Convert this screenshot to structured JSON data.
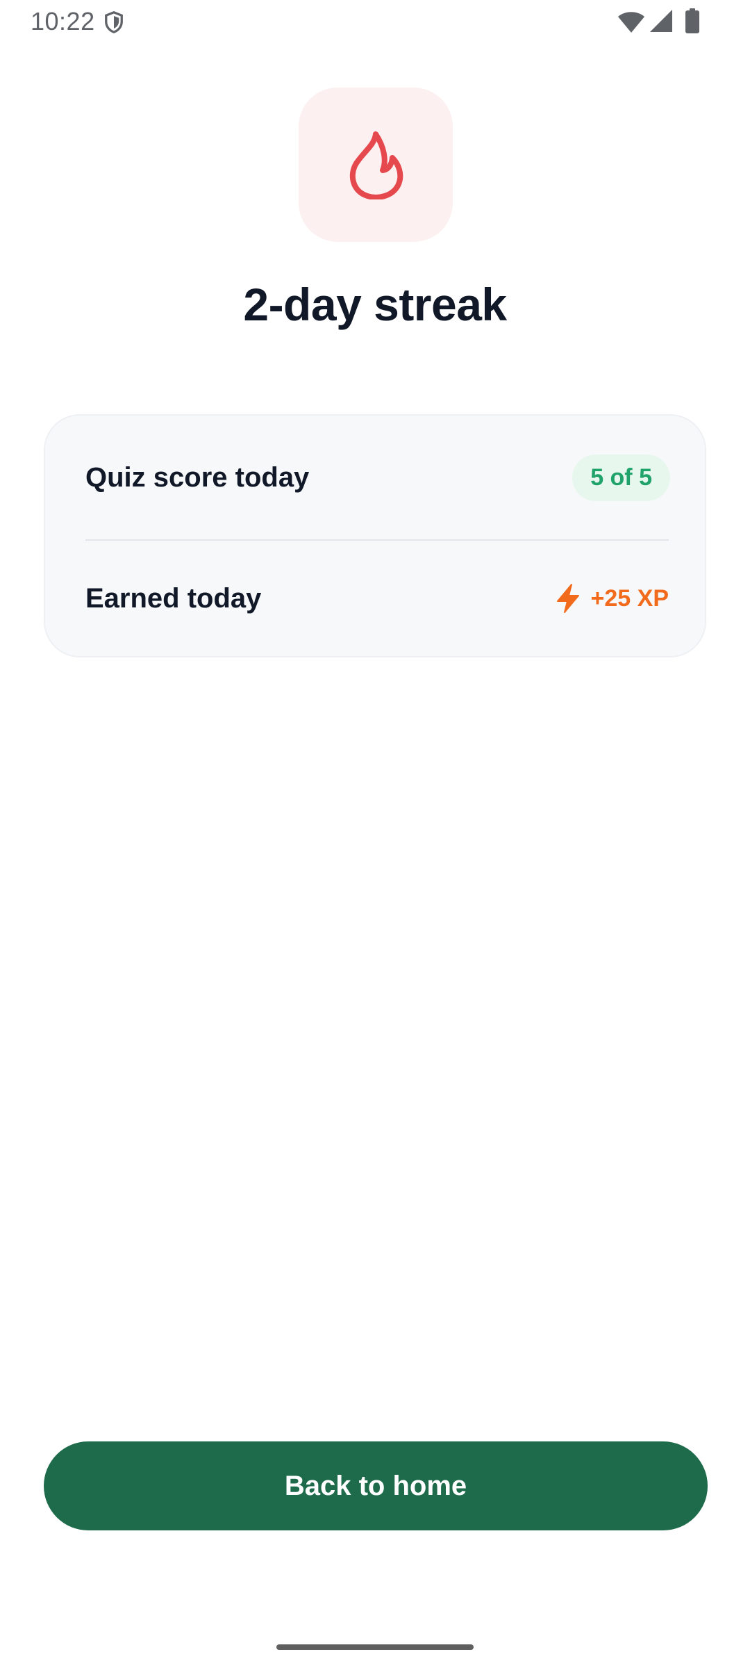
{
  "status_bar": {
    "time": "10:22",
    "icons": [
      "shield-icon",
      "wifi-icon",
      "cellular-signal-icon",
      "battery-icon"
    ]
  },
  "hero": {
    "icon": "flame-icon",
    "title": "2-day streak"
  },
  "stats": {
    "quiz_label": "Quiz score today",
    "quiz_score": "5 of 5",
    "earned_label": "Earned today",
    "earned_icon": "lightning-icon",
    "earned_value": "+25 XP"
  },
  "actions": {
    "back_home_label": "Back to home"
  },
  "colors": {
    "primary": "#1d6b4b",
    "flame": "#e5484d",
    "flame_bg": "#fdf0f0",
    "success": "#1fa36b",
    "success_bg": "#e8f7ee",
    "xp": "#f26a1b",
    "title": "#111827"
  }
}
